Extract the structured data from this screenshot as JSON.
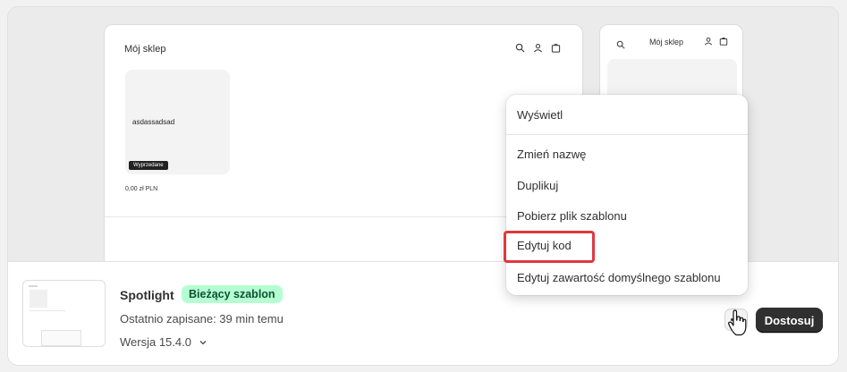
{
  "preview": {
    "desktop_store_name": "Mój sklep",
    "product_title": "asdassadsad",
    "product_badge": "Wyprzedane",
    "product_price": "0,00 zł PLN",
    "mobile_store_name": "Mój sklep"
  },
  "theme": {
    "name": "Spotlight",
    "badge": "Bieżący szablon",
    "saved": "Ostatnio zapisane: 39 min temu",
    "version": "Wersja 15.4.0"
  },
  "actions": {
    "customize_label": "Dostosuj"
  },
  "menu": {
    "items": [
      "Wyświetl",
      "Zmień nazwę",
      "Duplikuj",
      "Pobierz plik szablonu",
      "Edytuj kod",
      "Edytuj zawartość domyślnego szablonu"
    ]
  },
  "colors": {
    "highlight": "#e0383e",
    "badge_bg": "#b4fed2",
    "button_dark": "#303030"
  }
}
